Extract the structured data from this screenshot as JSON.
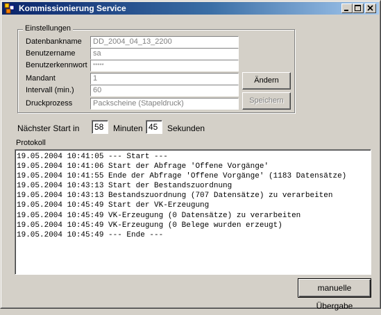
{
  "window": {
    "title": "Kommissionierung Service",
    "controls": [
      "minimize-icon",
      "maximize-icon",
      "close-icon"
    ]
  },
  "settings": {
    "legend": "Einstellungen",
    "fields": [
      {
        "label": "Datenbankname",
        "value": "DD_2004_04_13_2200"
      },
      {
        "label": "Benutzername",
        "value": "sa"
      },
      {
        "label": "Benutzerkennwort",
        "value": "*****"
      },
      {
        "label": "Mandant",
        "value": "1"
      },
      {
        "label": "Intervall (min.)",
        "value": "60"
      },
      {
        "label": "Druckprozess",
        "value": "Packscheine (Stapeldruck)"
      }
    ],
    "change_button": "Ändern",
    "save_button": "Speichern"
  },
  "next_start": {
    "label": "Nächster Start in",
    "minutes": "58",
    "minutes_label": "Minuten",
    "seconds": "45",
    "seconds_label": "Sekunden"
  },
  "protocol": {
    "label": "Protokoll",
    "lines": [
      "19.05.2004 10:41:05 --- Start ---",
      "19.05.2004 10:41:06 Start der Abfrage 'Offene Vorgänge'",
      "19.05.2004 10:41:55 Ende der Abfrage 'Offene Vorgänge' (1183 Datensätze)",
      "19.05.2004 10:43:13 Start der Bestandszuordnung",
      "19.05.2004 10:43:13 Bestandszuordnung (707 Datensätze) zu verarbeiten",
      "19.05.2004 10:45:49 Start der VK-Erzeugung",
      "19.05.2004 10:45:49 VK-Erzeugung (0 Datensätze) zu verarbeiten",
      "19.05.2004 10:45:49 VK-Erzeugung (0 Belege wurden erzeugt)",
      "19.05.2004 10:45:49 --- Ende ---"
    ]
  },
  "manual_button": "manuelle Übergabe",
  "colors": {
    "title_start": "#0a246a",
    "title_end": "#a6caf0",
    "face": "#d4d0c8"
  }
}
